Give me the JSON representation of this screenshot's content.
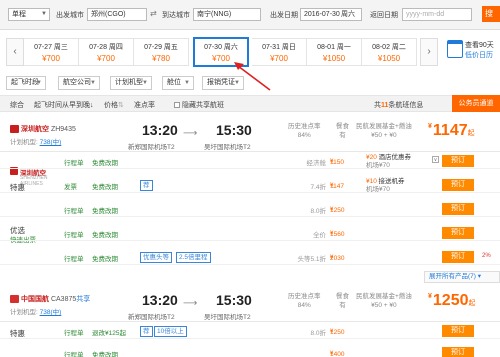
{
  "search": {
    "trip_type": "单程",
    "from_label": "出发城市",
    "from_value": "郑州(CGO)",
    "to_label": "到达城市",
    "to_value": "南宁(NNG)",
    "depart_label": "出发日期",
    "depart_value": "2016-07-30",
    "depart_weekday": "周六",
    "return_label": "返回日期",
    "return_placeholder": "yyyy-mm-dd",
    "search_button": "搜"
  },
  "dates": [
    {
      "date": "07-27 周三",
      "price": "¥700"
    },
    {
      "date": "07-28 周四",
      "price": "¥700"
    },
    {
      "date": "07-29 周五",
      "price": "¥780"
    },
    {
      "date": "07-30 周六",
      "price": "¥700"
    },
    {
      "date": "07-31 周日",
      "price": "¥700"
    },
    {
      "date": "08-01 周一",
      "price": "¥1050"
    },
    {
      "date": "08-02 周二",
      "price": "¥1050"
    }
  ],
  "calendar": {
    "line1": "查看90天",
    "line2": "低价日历"
  },
  "filters": [
    "起飞时段",
    "航空公司",
    "计划机型",
    "舱位",
    "报销凭证"
  ],
  "sortbar": {
    "composite": "综合",
    "depart_time": "起飞时间从早到晚",
    "price": "价格",
    "on_time": "准点率",
    "shared_hidden": "隐藏共享航班",
    "count_prefix": "共",
    "count": "11",
    "count_suffix": "条航班信息",
    "cheapest_button": "公务员通道"
  },
  "flight1": {
    "airline": "深圳航空",
    "flight_no": "ZH9435",
    "plane_label": "计划机型:",
    "plane": "738(中)",
    "dep_time": "13:20",
    "dep_airport": "新郑国际机场T2",
    "arr_time": "15:30",
    "arr_airport": "吴圩国际机场T2",
    "on_time_label": "历史准点率",
    "on_time_value": "84%",
    "meal_label": "餐食",
    "meal_value": "有",
    "tax_label": "民航发展基金+燃油",
    "tax_value": "¥50 + ¥0",
    "price": "1147",
    "price_suffix": "起"
  },
  "sub_airline": {
    "name": "深圳航空",
    "desc": "SHENZHEN AIRLINES"
  },
  "rows1": [
    {
      "cabin": "行程单",
      "rules": "免费改期",
      "tag": "",
      "tag2": "",
      "discount": "经济舱",
      "price": "1150",
      "gift_top": "¥20",
      "gift": "酒店优惠券",
      "gift_sub": "机场¥70",
      "expand": "∨"
    },
    {
      "cabin": "发票",
      "rules": "免费改期",
      "tag": "荐",
      "tag2": "",
      "discount": "7.4折",
      "price": "1147",
      "gift_top": "¥10",
      "gift": "接送机券",
      "gift_sub": "机场¥70",
      "expand": ""
    },
    {
      "cabin": "行程单",
      "rules": "免费改期",
      "tag": "",
      "tag2": "",
      "discount": "8.0折",
      "price": "1250",
      "gift_top": "",
      "gift": "",
      "gift_sub": "",
      "expand": ""
    },
    {
      "cabin": "行程单",
      "rules": "免费改期",
      "tag": "",
      "tag2": "",
      "discount": "全价",
      "price": "1560",
      "gift_top": "",
      "gift": "",
      "gift_sub": "",
      "expand": ""
    },
    {
      "cabin": "行程单",
      "rules": "免费改期",
      "tag": "优惠头等",
      "tag2": "2.5倍里程",
      "discount": "头等5.1折",
      "price": "2030",
      "gift_top": "",
      "gift": "",
      "gift_sub": "",
      "expand": ""
    }
  ],
  "groups1": {
    "special": "特惠",
    "preferred": "优选",
    "preferred_sub": "快速出票"
  },
  "more_button": "展开所有产品(7)",
  "book_label": "预订",
  "row_extra_mark": "2%",
  "flight2": {
    "airline": "中国国航",
    "flight_no": "CA3875",
    "share": "共享",
    "plane_label": "计划机型:",
    "plane": "738(中)",
    "dep_time": "13:20",
    "dep_airport": "新郑国际机场T2",
    "arr_time": "15:30",
    "arr_airport": "吴圩国际机场T2",
    "on_time_label": "历史准点率",
    "on_time_value": "84%",
    "meal_label": "餐食",
    "meal_value": "有",
    "tax_label": "民航发展基金+燃油",
    "tax_value": "¥50 + ¥0",
    "price": "1250",
    "price_suffix": "起"
  },
  "rows2": [
    {
      "cabin": "行程单",
      "rules": "退改¥125起",
      "tag": "荐",
      "tag2": "10倍以上",
      "discount": "8.0折",
      "price": "1250"
    },
    {
      "cabin": "行程单",
      "rules": "免费改期",
      "tag": "",
      "tag2": "",
      "discount": "",
      "price": "1400"
    }
  ],
  "groups2": {
    "special": "特惠"
  },
  "colors": {
    "accent": "#ff6600",
    "link": "#1f7ad8",
    "green": "#2d8a34",
    "airline_red": "#c81e1e"
  }
}
